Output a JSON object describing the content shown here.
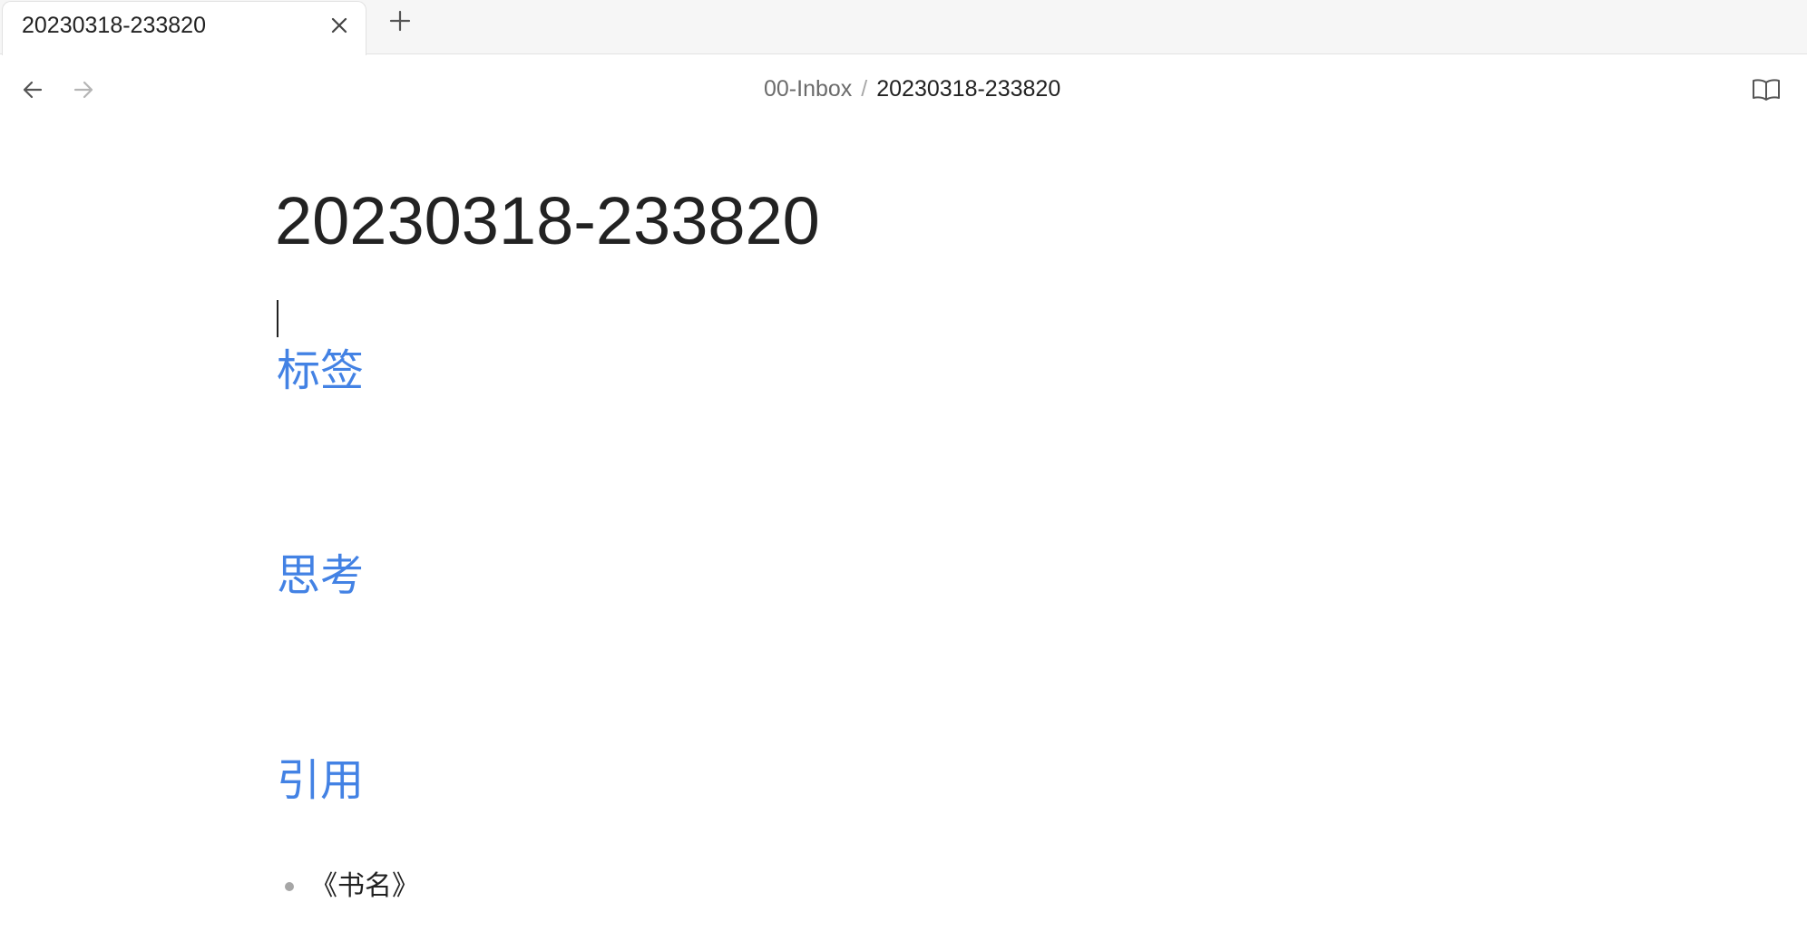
{
  "tabs": [
    {
      "title": "20230318-233820",
      "icon_close": "close-icon"
    }
  ],
  "tabbar": {
    "new_tab_icon": "plus-icon"
  },
  "nav": {
    "back_icon": "arrow-left-icon",
    "forward_icon": "arrow-right-icon",
    "breadcrumb_folder": "00-Inbox",
    "breadcrumb_separator": "/",
    "breadcrumb_file": "20230318-233820",
    "reading_view_icon": "book-open-icon"
  },
  "note": {
    "title": "20230318-233820",
    "sections": [
      {
        "heading": "标签"
      },
      {
        "heading": "思考"
      },
      {
        "heading": "引用",
        "items": [
          "《书名》"
        ]
      }
    ]
  },
  "colors": {
    "heading": "#4382e4",
    "text": "#222222",
    "muted": "#6b6b6b",
    "faint": "#a8a8a8",
    "tabbar_bg": "#f6f6f6"
  }
}
